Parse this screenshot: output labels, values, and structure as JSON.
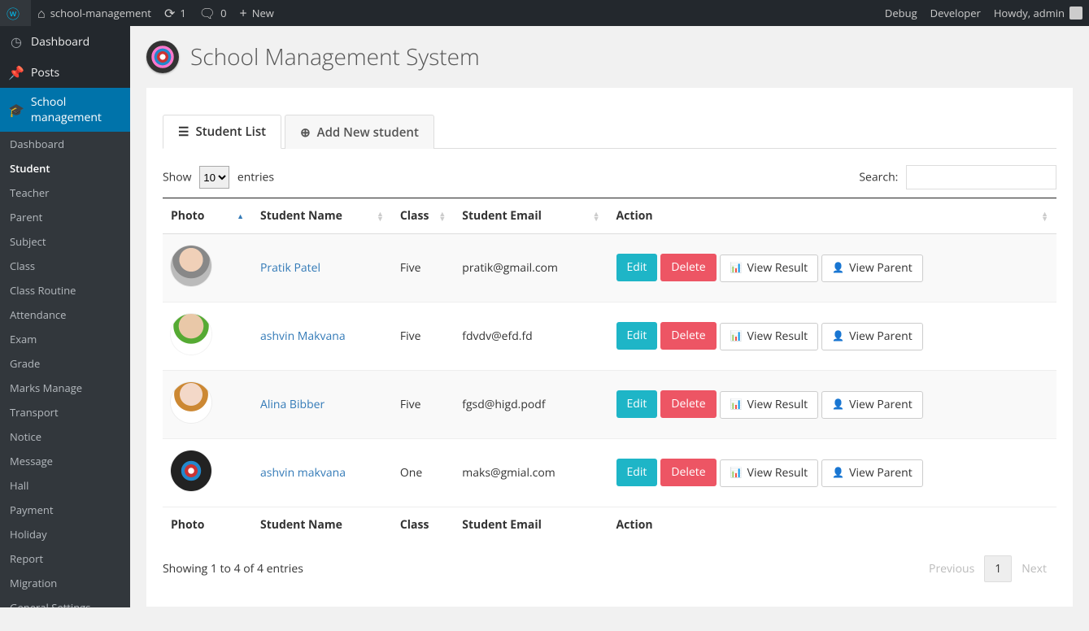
{
  "adminbar": {
    "site_name": "school-management",
    "updates_count": "1",
    "comments_count": "0",
    "new_label": "New",
    "debug_label": "Debug",
    "developer_label": "Developer",
    "howdy_label": "Howdy, admin"
  },
  "adminmenu": {
    "top": [
      {
        "label": "Dashboard",
        "icon": "dashboard-icon"
      },
      {
        "label": "Posts",
        "icon": "pin-icon"
      },
      {
        "label": "School management",
        "icon": "graduation-cap-icon",
        "current": true
      }
    ],
    "submenu": [
      {
        "label": "Dashboard"
      },
      {
        "label": "Student",
        "current": true
      },
      {
        "label": "Teacher"
      },
      {
        "label": "Parent"
      },
      {
        "label": "Subject"
      },
      {
        "label": "Class"
      },
      {
        "label": "Class Routine"
      },
      {
        "label": "Attendance"
      },
      {
        "label": "Exam"
      },
      {
        "label": "Grade"
      },
      {
        "label": "Marks Manage"
      },
      {
        "label": "Transport"
      },
      {
        "label": "Notice"
      },
      {
        "label": "Message"
      },
      {
        "label": "Hall"
      },
      {
        "label": "Payment"
      },
      {
        "label": "Holiday"
      },
      {
        "label": "Report"
      },
      {
        "label": "Migration"
      },
      {
        "label": "General Settings"
      }
    ]
  },
  "page": {
    "title": "School Management System"
  },
  "tabs": {
    "list": "Student List",
    "add": "Add New student"
  },
  "datatable": {
    "show_label_pre": "Show",
    "show_label_post": "entries",
    "show_value": "10",
    "search_label": "Search:",
    "search_value": "",
    "columns": [
      "Photo",
      "Student Name",
      "Class",
      "Student Email",
      "Action"
    ],
    "rows": [
      {
        "avatar": "a1",
        "name": "Pratik Patel",
        "class": "Five",
        "email": "pratik@gmail.com"
      },
      {
        "avatar": "a2",
        "name": "ashvin Makvana",
        "class": "Five",
        "email": "fdvdv@efd.fd"
      },
      {
        "avatar": "a3",
        "name": "Alina Bibber",
        "class": "Five",
        "email": "fgsd@higd.podf"
      },
      {
        "avatar": "a4",
        "name": "ashvin makvana",
        "class": "One",
        "email": "maks@gmial.com"
      }
    ],
    "action_labels": {
      "edit": "Edit",
      "delete": "Delete",
      "view_result": "View Result",
      "view_parent": "View Parent"
    },
    "info": "Showing 1 to 4 of 4 entries",
    "pagination": {
      "prev": "Previous",
      "current": "1",
      "next": "Next"
    }
  }
}
